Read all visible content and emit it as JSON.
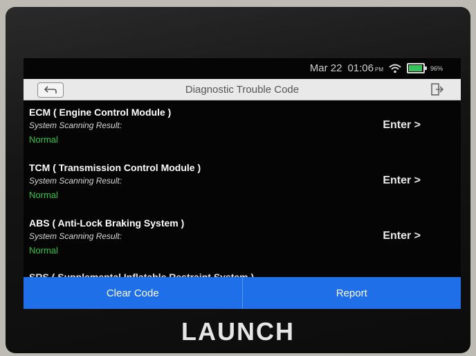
{
  "device": {
    "brand": "LAUNCH"
  },
  "status": {
    "date": "Mar 22",
    "time": "01:06",
    "ampm": "PM",
    "battery": "96%"
  },
  "header": {
    "title": "Diagnostic Trouble Code"
  },
  "modules": [
    {
      "name": "ECM ( Engine Control Module )",
      "sub": "System Scanning Result:",
      "status": "Normal",
      "action": "Enter >"
    },
    {
      "name": "TCM ( Transmission Control Module )",
      "sub": "System Scanning Result:",
      "status": "Normal",
      "action": "Enter >"
    },
    {
      "name": "ABS ( Anti-Lock Braking System )",
      "sub": "System Scanning Result:",
      "status": "Normal",
      "action": "Enter >"
    },
    {
      "name": "SRS ( Supplemental Inflatable Restraint System )"
    }
  ],
  "footer": {
    "clear": "Clear Code",
    "report": "Report"
  },
  "icons": {
    "back": "back-arrow-icon",
    "exit": "exit-icon",
    "wifi": "wifi-icon",
    "battery": "battery-icon"
  },
  "colors": {
    "accent": "#1f6fe8",
    "normal": "#27c93f"
  }
}
